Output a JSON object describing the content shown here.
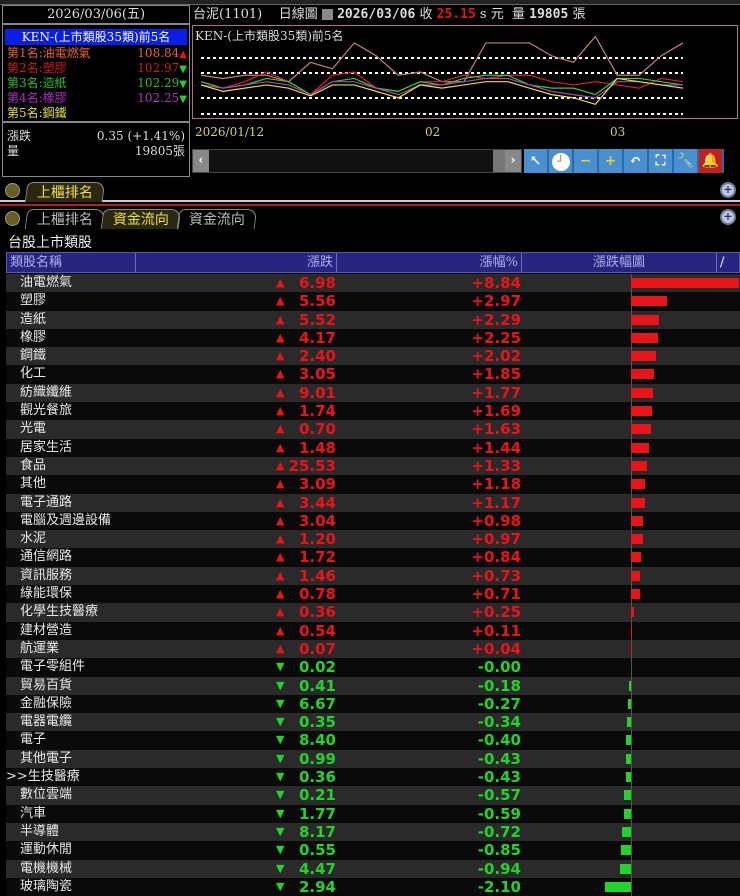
{
  "left_panel": {
    "date": "2026/03/06(五)",
    "rank_title": "KEN-(上市類股35類)前5名",
    "ranks": [
      {
        "label": "第1名:油電燃氣",
        "value": "108.84",
        "dir": "up",
        "color": "#e86030"
      },
      {
        "label": "第2名:塑膠",
        "value": "102.97",
        "dir": "down",
        "color": "#d01818"
      },
      {
        "label": "第3名:造紙",
        "value": "102.29",
        "dir": "down",
        "color": "#20c020"
      },
      {
        "label": "第4名:橡膠",
        "value": "102.25",
        "dir": "down",
        "color": "#b030c0"
      },
      {
        "label": "第5名:鋼鐵",
        "value": "",
        "dir": "",
        "color": "#e0e030"
      }
    ],
    "change_label": "漲跌",
    "change_value": "0.35 (+1.41%)",
    "volume_label": "量",
    "volume_value": "19805張"
  },
  "chart_header": {
    "stock": "台泥(1101)",
    "chart_type": "日線圖",
    "date": "2026/03/06",
    "close_label": "收",
    "close": "25.15",
    "suffix": "s 元",
    "vol_label": "量",
    "volume": "19805",
    "vol_unit": "張"
  },
  "chart_data": {
    "type": "line",
    "title": "KEN-(上市類股35類)前5名",
    "x_ticks": [
      "2026/01/12",
      "02",
      "03"
    ],
    "series": [
      {
        "name": "油電燃氣",
        "color": "#c08080",
        "values": [
          101,
          100.5,
          101,
          101,
          100,
          103,
          102,
          106,
          104,
          101,
          101.5,
          100,
          100,
          106,
          106,
          106,
          104,
          103,
          107,
          101,
          101,
          104,
          106
        ]
      },
      {
        "name": "塑膠",
        "color": "#e02020",
        "values": [
          100,
          99,
          100,
          101.5,
          100,
          98,
          101,
          101.5,
          99,
          98.5,
          100,
          100,
          101,
          100.5,
          101,
          101,
          100,
          99.5,
          100,
          99.5,
          99,
          100.5,
          100
        ]
      },
      {
        "name": "造紙",
        "color": "#30d030",
        "values": [
          100,
          99,
          99.5,
          100.5,
          100,
          98,
          100,
          100.5,
          99,
          98.5,
          100,
          99.5,
          100.5,
          101,
          101,
          99.5,
          99,
          99,
          98,
          100.5,
          100.5,
          100,
          99.5
        ]
      },
      {
        "name": "橡膠",
        "color": "#b040c0",
        "values": [
          99.5,
          99,
          99.5,
          100,
          99.5,
          98,
          100,
          100,
          99,
          98,
          99.5,
          99.5,
          100,
          100.5,
          100.5,
          99.5,
          98.5,
          98,
          97.5,
          100,
          100,
          99.5,
          99.5
        ]
      },
      {
        "name": "鋼鐵",
        "color": "#e0e040",
        "values": [
          99.5,
          98.5,
          99,
          99.5,
          99,
          97.8,
          99.5,
          99.5,
          98.5,
          97.5,
          99.5,
          99,
          99.5,
          100,
          100,
          99,
          98,
          97.5,
          96.5,
          100.5,
          100,
          99.5,
          99
        ]
      }
    ]
  },
  "toolbar": [
    "arrow",
    "clock",
    "minus",
    "plus",
    "undo",
    "fit",
    "wrench",
    "bell"
  ],
  "panel2": {
    "tab": "上櫃排名"
  },
  "panel3": {
    "tabs": [
      "上櫃排名",
      "資金流向",
      "資金流向"
    ],
    "active_tab": 1,
    "title": "台股上市類股",
    "columns": [
      "類股名稱",
      "漲跌",
      "漲幅%",
      "漲跌幅圖"
    ],
    "col_marker": "/",
    "rows": [
      {
        "name": "油電燃氣",
        "chg": "6.98",
        "pct": "+8.84",
        "v": 8.84
      },
      {
        "name": "塑膠",
        "chg": "5.56",
        "pct": "+2.97",
        "v": 2.97
      },
      {
        "name": "造紙",
        "chg": "5.52",
        "pct": "+2.29",
        "v": 2.29
      },
      {
        "name": "橡膠",
        "chg": "4.17",
        "pct": "+2.25",
        "v": 2.25
      },
      {
        "name": "鋼鐵",
        "chg": "2.40",
        "pct": "+2.02",
        "v": 2.02
      },
      {
        "name": "化工",
        "chg": "3.05",
        "pct": "+1.85",
        "v": 1.85
      },
      {
        "name": "紡織纖維",
        "chg": "9.01",
        "pct": "+1.77",
        "v": 1.77
      },
      {
        "name": "觀光餐旅",
        "chg": "1.74",
        "pct": "+1.69",
        "v": 1.69
      },
      {
        "name": "光電",
        "chg": "0.70",
        "pct": "+1.63",
        "v": 1.63
      },
      {
        "name": "居家生活",
        "chg": "1.48",
        "pct": "+1.44",
        "v": 1.44
      },
      {
        "name": "食品",
        "chg": "25.53",
        "pct": "+1.33",
        "v": 1.33
      },
      {
        "name": "其他",
        "chg": "3.09",
        "pct": "+1.18",
        "v": 1.18
      },
      {
        "name": "電子通路",
        "chg": "3.44",
        "pct": "+1.17",
        "v": 1.17
      },
      {
        "name": "電腦及週邊設備",
        "chg": "3.04",
        "pct": "+0.98",
        "v": 0.98
      },
      {
        "name": "水泥",
        "chg": "1.20",
        "pct": "+0.97",
        "v": 0.97
      },
      {
        "name": "通信網路",
        "chg": "1.72",
        "pct": "+0.84",
        "v": 0.84
      },
      {
        "name": "資訊服務",
        "chg": "1.46",
        "pct": "+0.73",
        "v": 0.73
      },
      {
        "name": "綠能環保",
        "chg": "0.78",
        "pct": "+0.71",
        "v": 0.71
      },
      {
        "name": "化學生技醫療",
        "chg": "0.36",
        "pct": "+0.25",
        "v": 0.25
      },
      {
        "name": "建材營造",
        "chg": "0.54",
        "pct": "+0.11",
        "v": 0.11
      },
      {
        "name": "航運業",
        "chg": "0.07",
        "pct": "+0.04",
        "v": 0.04
      },
      {
        "name": "電子零組件",
        "chg": "0.02",
        "pct": "-0.00",
        "v": -0.0
      },
      {
        "name": "貿易百貨",
        "chg": "0.41",
        "pct": "-0.18",
        "v": -0.18
      },
      {
        "name": "金融保險",
        "chg": "6.67",
        "pct": "-0.27",
        "v": -0.27
      },
      {
        "name": "電器電纜",
        "chg": "0.35",
        "pct": "-0.34",
        "v": -0.34
      },
      {
        "name": "電子",
        "chg": "8.40",
        "pct": "-0.40",
        "v": -0.4
      },
      {
        "name": "其他電子",
        "chg": "0.99",
        "pct": "-0.43",
        "v": -0.43
      },
      {
        "name": ">>生技醫療",
        "chg": "0.36",
        "pct": "-0.43",
        "v": -0.43
      },
      {
        "name": "數位雲端",
        "chg": "0.21",
        "pct": "-0.57",
        "v": -0.57
      },
      {
        "name": "汽車",
        "chg": "1.77",
        "pct": "-0.59",
        "v": -0.59
      },
      {
        "name": "半導體",
        "chg": "8.17",
        "pct": "-0.72",
        "v": -0.72
      },
      {
        "name": "運動休閒",
        "chg": "0.55",
        "pct": "-0.85",
        "v": -0.85
      },
      {
        "name": "電機機械",
        "chg": "4.47",
        "pct": "-0.94",
        "v": -0.94
      },
      {
        "name": "玻璃陶瓷",
        "chg": "2.94",
        "pct": "-2.10",
        "v": -2.1
      }
    ]
  },
  "colors": {
    "up": "#e8141a",
    "down": "#22d42a",
    "header_bg": "#262680"
  }
}
